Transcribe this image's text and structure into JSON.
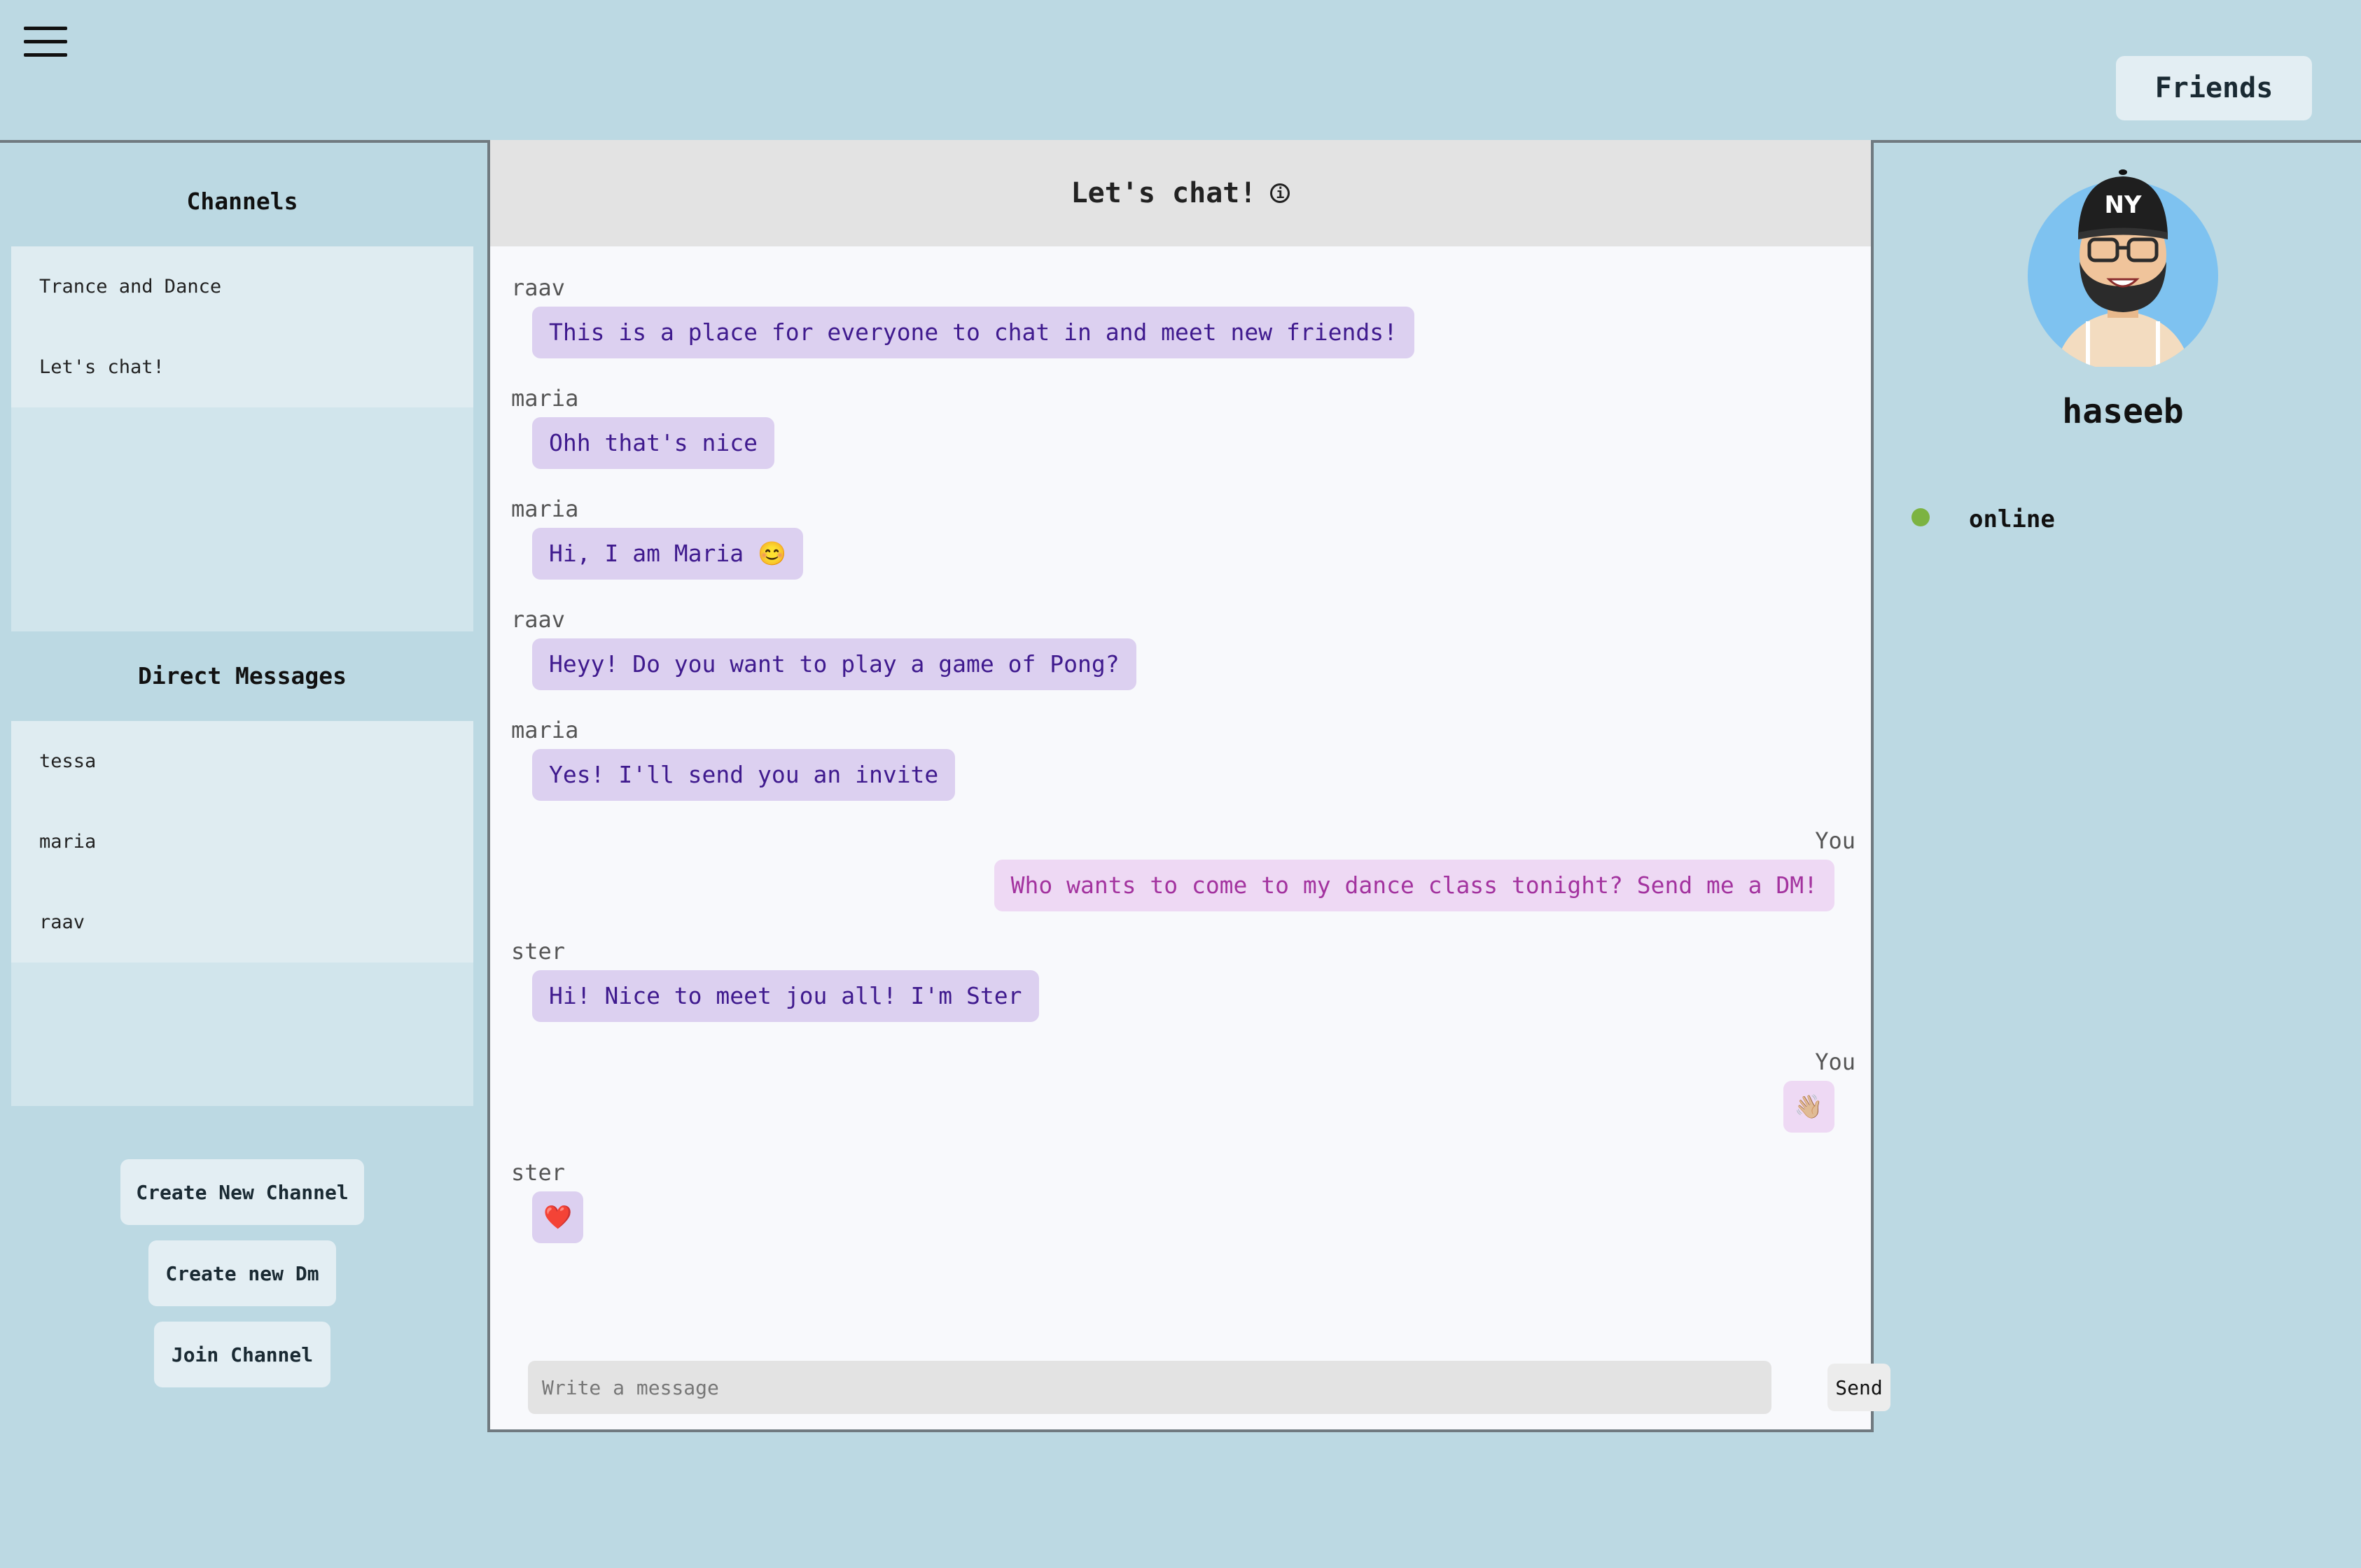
{
  "header": {
    "menu_icon": "hamburger-menu-icon",
    "friends_label": "Friends"
  },
  "sidebar": {
    "channels_title": "Channels",
    "channels": [
      {
        "label": "Trance and Dance"
      },
      {
        "label": "Let's chat!"
      }
    ],
    "dms_title": "Direct Messages",
    "dms": [
      {
        "label": "tessa"
      },
      {
        "label": "maria"
      },
      {
        "label": "raav"
      }
    ],
    "buttons": {
      "create_channel": "Create New Channel",
      "create_dm": "Create new Dm",
      "join_channel": "Join Channel"
    }
  },
  "chat": {
    "title": "Let's chat!",
    "info_icon": "info-icon",
    "messages": [
      {
        "author": "raav",
        "text": "This is a place for everyone to chat in and meet new friends!",
        "mine": false
      },
      {
        "author": "maria",
        "text": "Ohh that's nice",
        "mine": false
      },
      {
        "author": "maria",
        "text": "Hi, I am Maria 😊",
        "mine": false
      },
      {
        "author": "raav",
        "text": "Heyy! Do you want to play a game of Pong?",
        "mine": false
      },
      {
        "author": "maria",
        "text": "Yes! I'll send you an invite",
        "mine": false
      },
      {
        "author": "You",
        "text": "Who wants to come to my dance class tonight? Send me a DM!",
        "mine": true
      },
      {
        "author": "ster",
        "text": "Hi! Nice to meet jou all! I'm Ster",
        "mine": false
      },
      {
        "author": "You",
        "text": "👋🏼",
        "mine": true
      },
      {
        "author": "ster",
        "text": "❤️",
        "mine": false
      }
    ],
    "composer": {
      "placeholder": "Write a message",
      "send_label": "Send"
    }
  },
  "profile": {
    "name": "haseeb",
    "status": "online",
    "status_color": "#7cb342",
    "cap_logo": "NY"
  },
  "colors": {
    "background": "#bcd9e3",
    "bubble_other": "#dcd0f0",
    "bubble_other_text": "#3f1a8e",
    "bubble_mine": "#eed9f4",
    "bubble_mine_text": "#a3339f"
  }
}
